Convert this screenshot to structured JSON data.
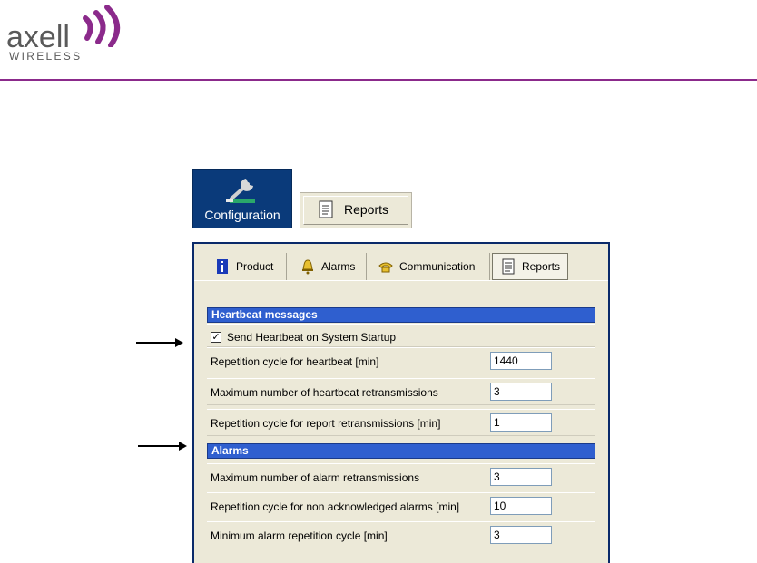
{
  "logo": {
    "brand": "axell",
    "sub": "WIRELESS"
  },
  "toolbar": {
    "configuration_label": "Configuration",
    "reports_label": "Reports"
  },
  "tabs": [
    {
      "label": "Product",
      "icon": "info-icon"
    },
    {
      "label": "Alarms",
      "icon": "bell-icon"
    },
    {
      "label": "Communication",
      "icon": "phone-icon"
    },
    {
      "label": "Reports",
      "icon": "report-icon",
      "active": true
    }
  ],
  "heartbeat": {
    "header": "Heartbeat messages",
    "startup_checkbox": {
      "label": "Send Heartbeat on System Startup",
      "checked": true
    },
    "rows": [
      {
        "label": "Repetition cycle for heartbeat [min]",
        "value": "1440"
      },
      {
        "label": "Maximum number of heartbeat retransmissions",
        "value": "3"
      },
      {
        "label": "Repetition cycle for report retransmissions [min]",
        "value": "1"
      }
    ]
  },
  "alarms": {
    "header": "Alarms",
    "rows": [
      {
        "label": "Maximum number of alarm retransmissions",
        "value": "3"
      },
      {
        "label": "Repetition cycle for non acknowledged alarms [min]",
        "value": "10"
      },
      {
        "label": "Minimum alarm repetition cycle [min]",
        "value": "3"
      }
    ]
  },
  "colors": {
    "brand_purple": "#8b2a8b",
    "section_blue": "#2f5fcf",
    "config_blue": "#0a3a7a"
  }
}
